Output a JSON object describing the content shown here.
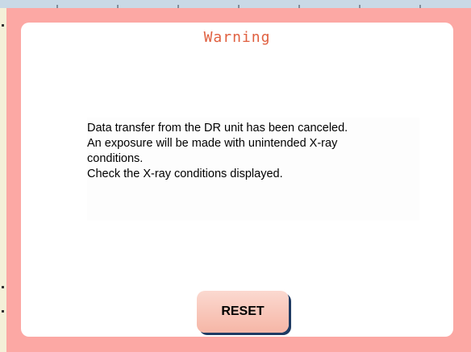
{
  "dialog": {
    "title": "Warning",
    "message_lines": [
      "Data transfer from the DR unit has been canceled.",
      "An exposure will be made with unintended X-ray",
      "conditions.",
      "Check the X-ray conditions displayed."
    ],
    "reset_label": "RESET"
  },
  "colors": {
    "dialog_frame": "#fca8a4",
    "panel": "#ffffff",
    "title_text": "#e06040",
    "button_shadow": "#1f3b63"
  }
}
